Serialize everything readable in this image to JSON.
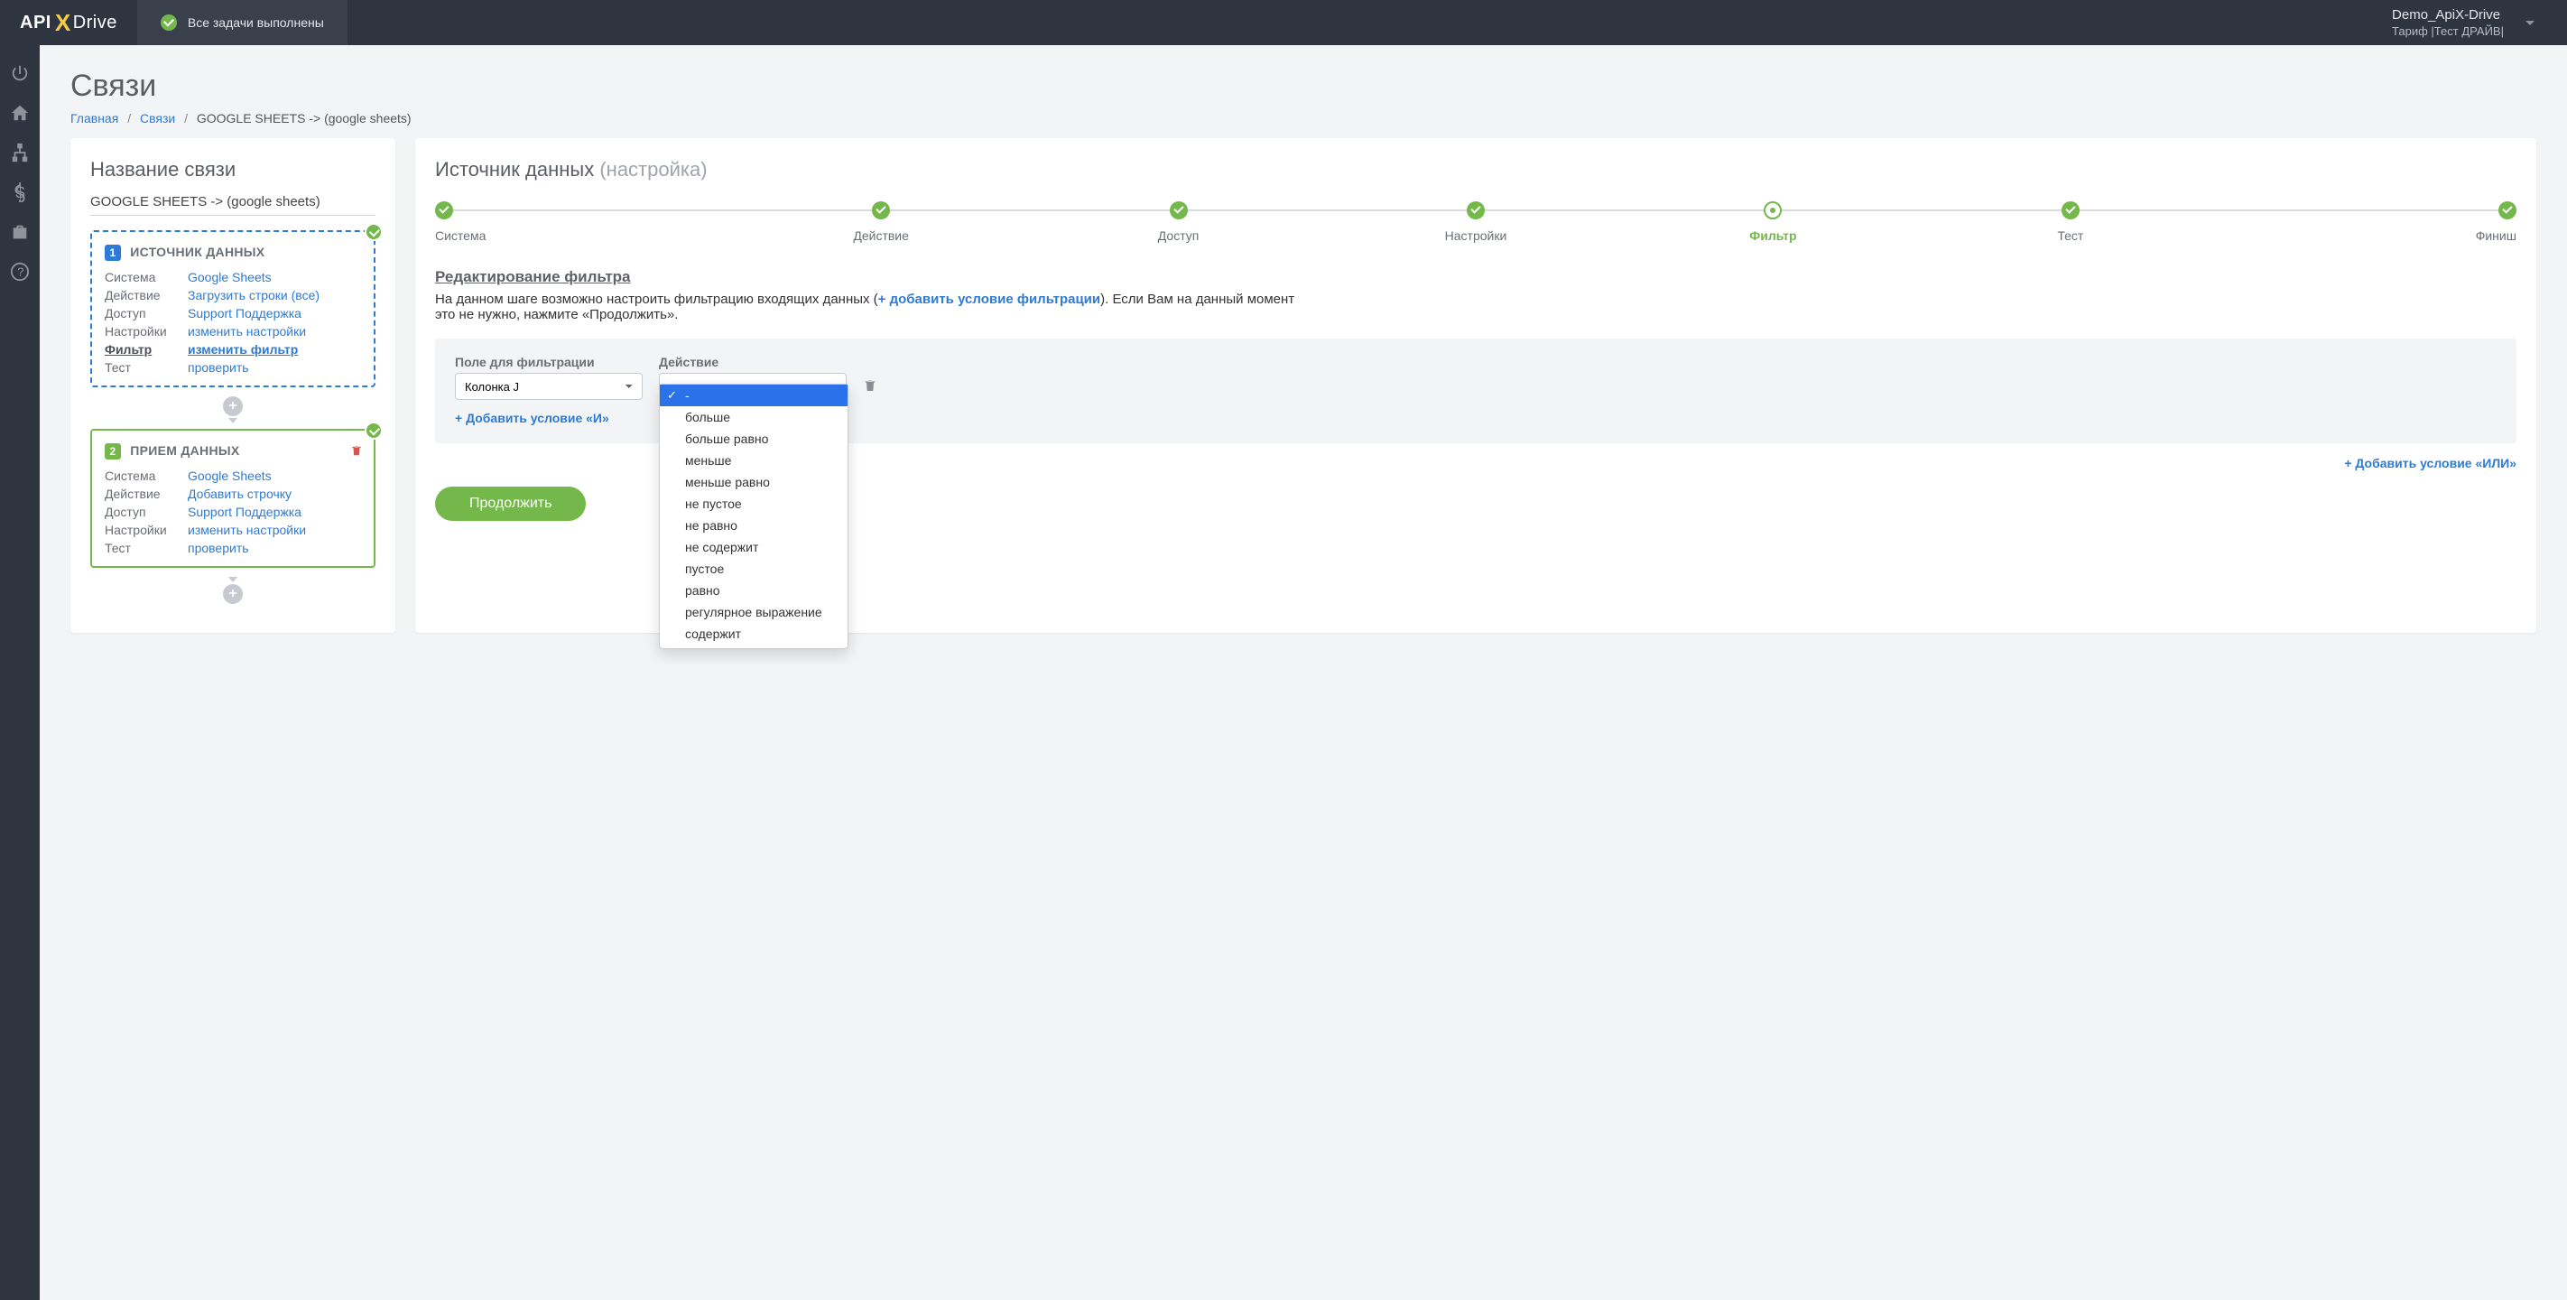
{
  "topbar": {
    "logo_pre": "API",
    "logo_x": "X",
    "logo_post": "Drive",
    "tasks_ok": "Все задачи выполнены",
    "user_name": "Demo_ApiX-Drive",
    "tariff": "Тариф |Тест ДРАЙВ|"
  },
  "page": {
    "title": "Связи",
    "crumb_home": "Главная",
    "crumb_links": "Связи",
    "crumb_current": "GOOGLE SHEETS -> (google sheets)"
  },
  "left": {
    "name_label": "Название связи",
    "name_value": "GOOGLE SHEETS -> (google sheets)",
    "src_title": "ИСТОЧНИК ДАННЫХ",
    "src": {
      "system_k": "Система",
      "system_v": "Google Sheets",
      "action_k": "Действие",
      "action_v": "Загрузить строки (все)",
      "access_k": "Доступ",
      "access_v": "Support Поддержка",
      "sett_k": "Настройки",
      "sett_v": "изменить настройки",
      "filter_k": "Фильтр",
      "filter_v": "изменить фильтр",
      "test_k": "Тест",
      "test_v": "проверить"
    },
    "dest_title": "ПРИЕМ ДАННЫХ",
    "dest": {
      "system_k": "Система",
      "system_v": "Google Sheets",
      "action_k": "Действие",
      "action_v": "Добавить строчку",
      "access_k": "Доступ",
      "access_v": "Support Поддержка",
      "sett_k": "Настройки",
      "sett_v": "изменить настройки",
      "test_k": "Тест",
      "test_v": "проверить"
    }
  },
  "right": {
    "title_main": "Источник данных",
    "title_sub": "(настройка)",
    "steps": [
      "Система",
      "Действие",
      "Доступ",
      "Настройки",
      "Фильтр",
      "Тест",
      "Финиш"
    ],
    "subhead": "Редактирование фильтра",
    "explain_pre": "На данном шаге возможно настроить фильтрацию входящих данных (",
    "explain_link": "+ добавить условие фильтрации",
    "explain_post": "). Если Вам на данный момент это не нужно, нажмите «Продолжить».",
    "filter": {
      "field_label": "Поле для фильтрации",
      "field_value": "Колонка J",
      "action_label": "Действие",
      "add_and": "Добавить условие «И»",
      "add_or": "Добавить условие «ИЛИ»",
      "continue": "Продолжить"
    },
    "dropdown": [
      "-",
      "больше",
      "больше равно",
      "меньше",
      "меньше равно",
      "не пустое",
      "не равно",
      "не содержит",
      "пустое",
      "равно",
      "регулярное выражение",
      "содержит"
    ]
  }
}
